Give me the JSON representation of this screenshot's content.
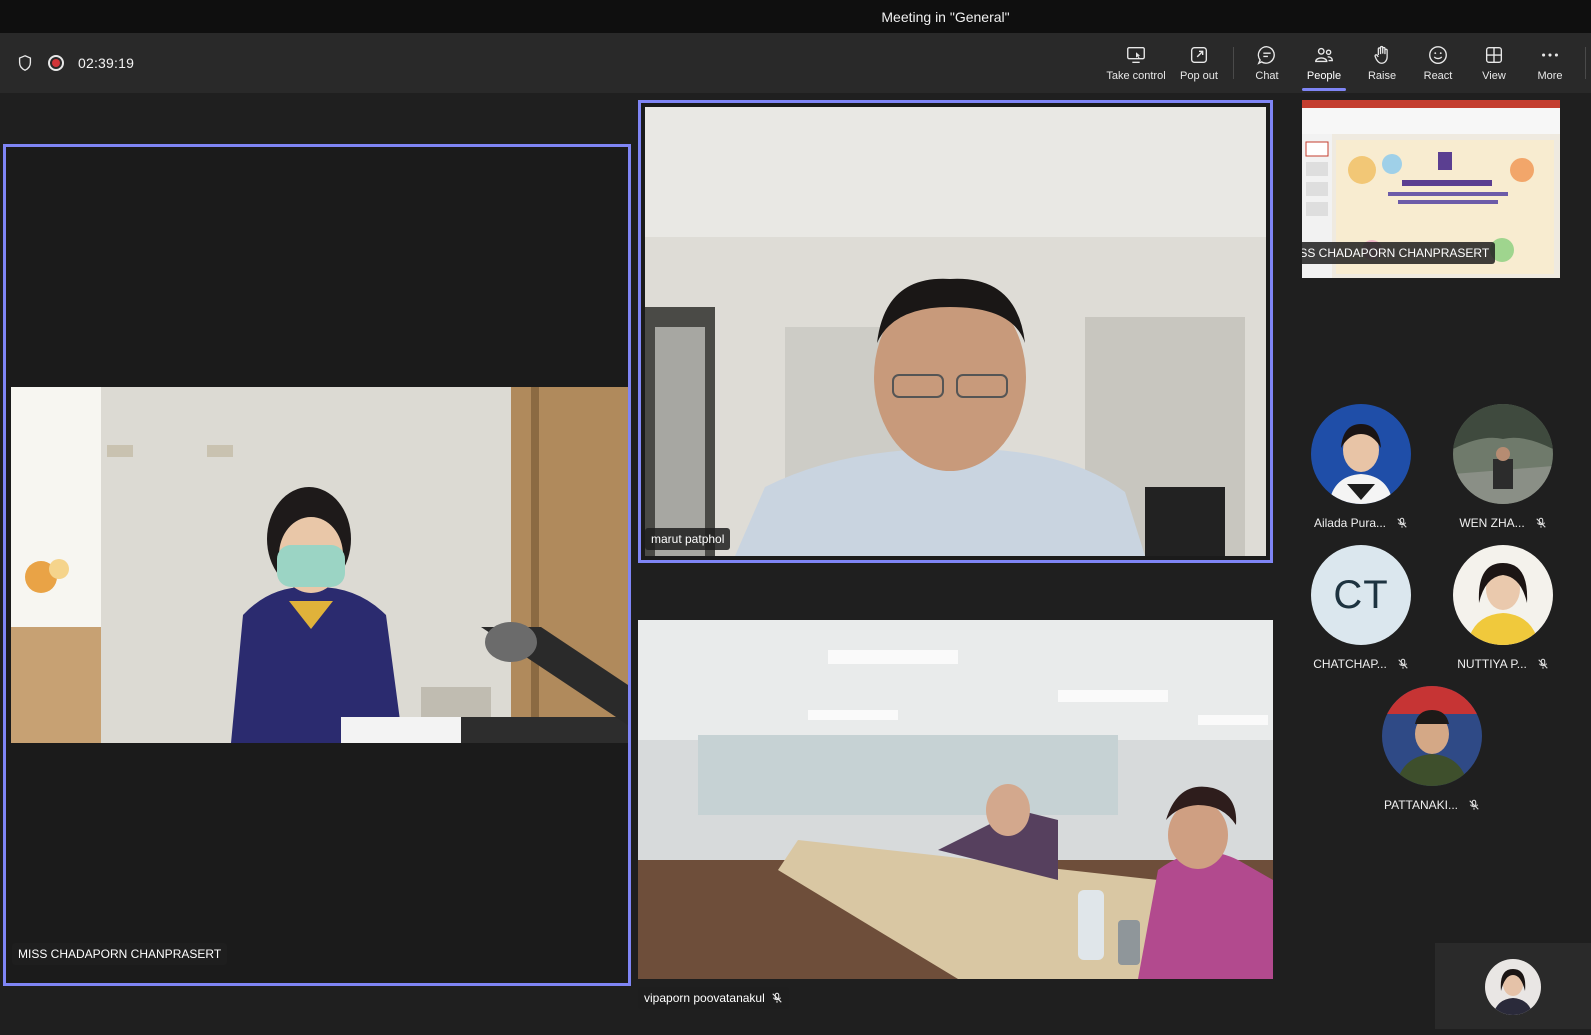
{
  "window": {
    "title": "Meeting in \"General\""
  },
  "toolbar": {
    "timer": "02:39:19",
    "buttons": {
      "take_control": "Take control",
      "pop_out": "Pop out",
      "chat": "Chat",
      "people": "People",
      "raise": "Raise",
      "react": "React",
      "view": "View",
      "more": "More"
    },
    "active_button": "people"
  },
  "stage": {
    "left_tile": {
      "name": "MISS CHADAPORN CHANPRASERT"
    },
    "top_right_tile": {
      "name": "marut patphol"
    },
    "bottom_right_tile": {
      "name": "vipaporn poovatanakul"
    }
  },
  "share_preview": {
    "name": "MISS CHADAPORN CHANPRASERT"
  },
  "participants": [
    {
      "name": "Ailada Pura...",
      "muted": true
    },
    {
      "name": "WEN ZHA...",
      "muted": true
    },
    {
      "name": "CHATCHAP...",
      "initials": "CT",
      "muted": true
    },
    {
      "name": "NUTTIYA P...",
      "muted": true
    },
    {
      "name": "PATTANAKI...",
      "muted": true
    }
  ],
  "colors": {
    "accent": "#7f85f5",
    "record": "#d13438",
    "background": "#1f1f1f"
  }
}
